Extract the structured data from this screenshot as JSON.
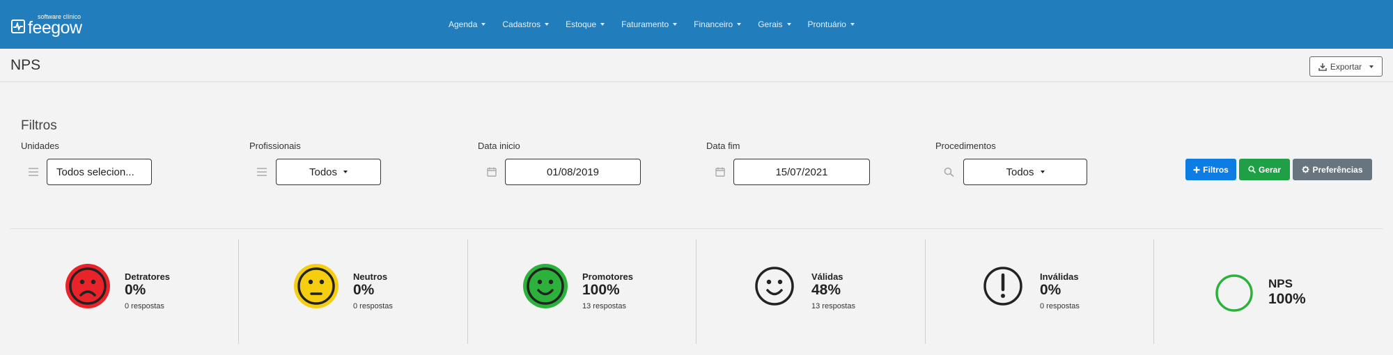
{
  "app": {
    "logo_sub": "software clínico",
    "logo_main": "feegow"
  },
  "nav": {
    "items": [
      {
        "label": "Agenda"
      },
      {
        "label": "Cadastros"
      },
      {
        "label": "Estoque"
      },
      {
        "label": "Faturamento"
      },
      {
        "label": "Financeiro"
      },
      {
        "label": "Gerais"
      },
      {
        "label": "Prontuário"
      }
    ]
  },
  "page": {
    "title": "NPS",
    "export_label": "Exportar"
  },
  "filters": {
    "title": "Filtros",
    "unidades": {
      "label": "Unidades",
      "value": "Todos selecion..."
    },
    "profissionais": {
      "label": "Profissionais",
      "value": "Todos"
    },
    "data_inicio": {
      "label": "Data inicio",
      "value": "01/08/2019"
    },
    "data_fim": {
      "label": "Data fim",
      "value": "15/07/2021"
    },
    "procedimentos": {
      "label": "Procedimentos",
      "value": "Todos"
    },
    "buttons": {
      "filtros": "Filtros",
      "gerar": "Gerar",
      "preferencias": "Preferências"
    }
  },
  "stats": {
    "detratores": {
      "label": "Detratores",
      "value": "0%",
      "sub": "0 respostas",
      "color": "#e8242a"
    },
    "neutros": {
      "label": "Neutros",
      "value": "0%",
      "sub": "0 respostas",
      "color": "#f5ce0f"
    },
    "promotores": {
      "label": "Promotores",
      "value": "100%",
      "sub": "13 respostas",
      "color": "#2cb23c"
    },
    "validas": {
      "label": "Válidas",
      "value": "48%",
      "sub": "13 respostas"
    },
    "invalidas": {
      "label": "Inválidas",
      "value": "0%",
      "sub": "0 respostas"
    },
    "nps": {
      "label": "NPS",
      "value": "100%",
      "color": "#2cb23c"
    }
  },
  "colors": {
    "navbar": "#217dbb",
    "btn_blue": "#0d7de3",
    "btn_green": "#1fa046",
    "btn_gray": "#68757f"
  }
}
